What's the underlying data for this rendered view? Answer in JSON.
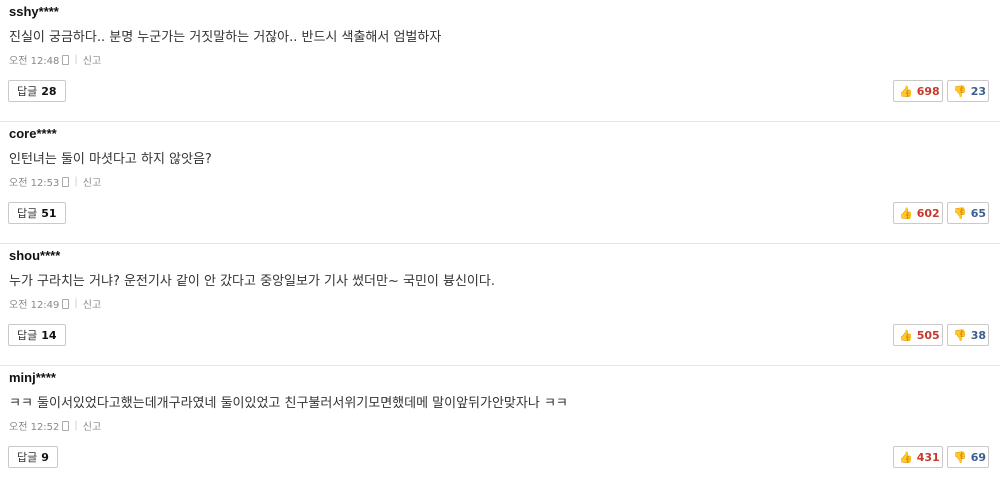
{
  "comments": [
    {
      "author": "sshy****",
      "text": "진실이 궁금하다.. 분명 누군가는 거짓말하는 거잖아.. 반드시 색출해서 엄벌하자",
      "time": "오전 12:48",
      "report_label": "신고",
      "reply_label": "답글",
      "reply_count": "28",
      "likes": "698",
      "dislikes": "23"
    },
    {
      "author": "core****",
      "text": "인턴녀는 둘이 마셧다고 하지 않앗음?",
      "time": "오전 12:53",
      "report_label": "신고",
      "reply_label": "답글",
      "reply_count": "51",
      "likes": "602",
      "dislikes": "65"
    },
    {
      "author": "shou****",
      "text": "누가 구라치는 거냐? 운전기사 같이 안 갔다고 중앙일보가 기사 썼더만~ 국민이 븅신이다.",
      "time": "오전 12:49",
      "report_label": "신고",
      "reply_label": "답글",
      "reply_count": "14",
      "likes": "505",
      "dislikes": "38"
    },
    {
      "author": "minj****",
      "text": "ㅋㅋ 둘이서있었다고했는데개구라였네 둘이있었고 친구불러서위기모면했데메 말이앞뒤가안맞자나 ㅋㅋ",
      "time": "오전 12:52",
      "report_label": "신고",
      "reply_label": "답글",
      "reply_count": "9",
      "likes": "431",
      "dislikes": "69"
    }
  ],
  "icons": {
    "mobile": "mobile-device-icon",
    "like": "thumbs-up-icon",
    "dislike": "thumbs-down-icon"
  },
  "colors": {
    "like_text": "#c8392b",
    "dislike_text": "#3b5f8f"
  }
}
